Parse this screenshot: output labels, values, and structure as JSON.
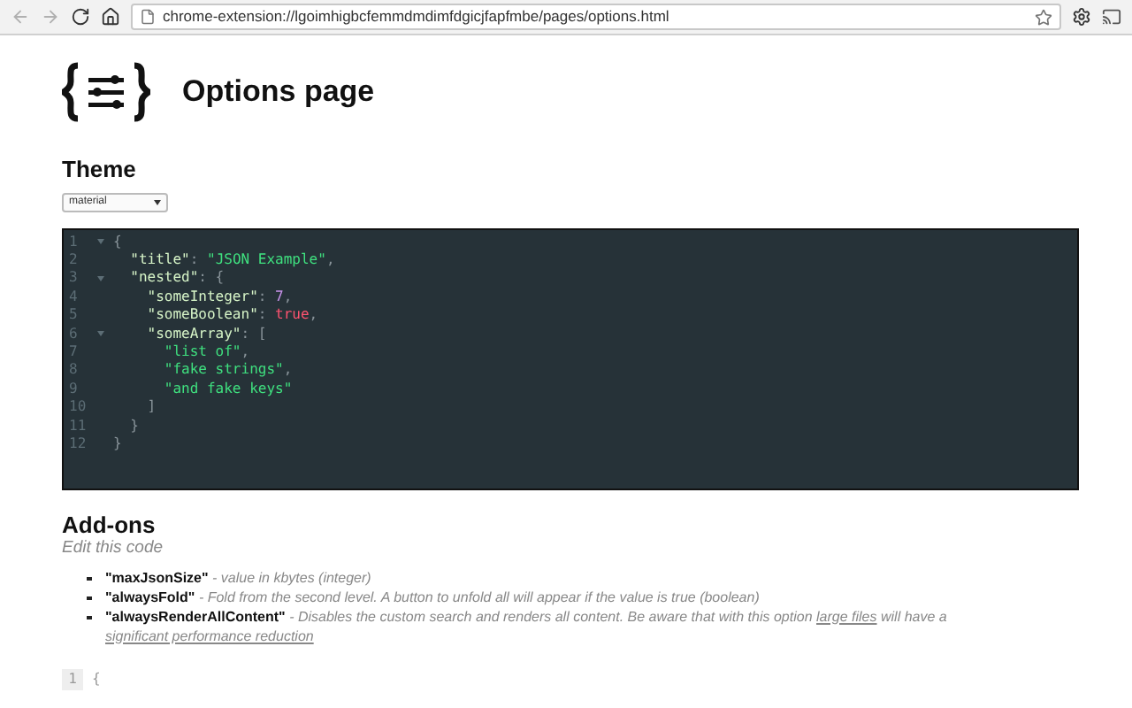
{
  "browser": {
    "url": "chrome-extension://lgoimhigbcfemmdmdimfdgicjfapfmbe/pages/options.html"
  },
  "page": {
    "title": "Options page"
  },
  "theme": {
    "heading": "Theme",
    "select_value": "material"
  },
  "editor": {
    "lines": [
      {
        "number": "1",
        "foldable": true,
        "tokens": [
          {
            "kind": "punct",
            "text": "{"
          }
        ]
      },
      {
        "number": "2",
        "foldable": false,
        "tokens": [
          {
            "kind": "key",
            "text": "  \"title\""
          },
          {
            "kind": "punct",
            "text": ": "
          },
          {
            "kind": "string",
            "text": "\"JSON Example\""
          },
          {
            "kind": "punct",
            "text": ","
          }
        ]
      },
      {
        "number": "3",
        "foldable": true,
        "tokens": [
          {
            "kind": "key",
            "text": "  \"nested\""
          },
          {
            "kind": "punct",
            "text": ": {"
          }
        ]
      },
      {
        "number": "4",
        "foldable": false,
        "tokens": [
          {
            "kind": "key",
            "text": "    \"someInteger\""
          },
          {
            "kind": "punct",
            "text": ": "
          },
          {
            "kind": "number",
            "text": "7"
          },
          {
            "kind": "punct",
            "text": ","
          }
        ]
      },
      {
        "number": "5",
        "foldable": false,
        "tokens": [
          {
            "kind": "key",
            "text": "    \"someBoolean\""
          },
          {
            "kind": "punct",
            "text": ": "
          },
          {
            "kind": "bool",
            "text": "true"
          },
          {
            "kind": "punct",
            "text": ","
          }
        ]
      },
      {
        "number": "6",
        "foldable": true,
        "tokens": [
          {
            "kind": "key",
            "text": "    \"someArray\""
          },
          {
            "kind": "punct",
            "text": ": ["
          }
        ]
      },
      {
        "number": "7",
        "foldable": false,
        "tokens": [
          {
            "kind": "string",
            "text": "      \"list of\""
          },
          {
            "kind": "punct",
            "text": ","
          }
        ]
      },
      {
        "number": "8",
        "foldable": false,
        "tokens": [
          {
            "kind": "string",
            "text": "      \"fake strings\""
          },
          {
            "kind": "punct",
            "text": ","
          }
        ]
      },
      {
        "number": "9",
        "foldable": false,
        "tokens": [
          {
            "kind": "string",
            "text": "      \"and fake keys\""
          }
        ]
      },
      {
        "number": "10",
        "foldable": false,
        "tokens": [
          {
            "kind": "punct",
            "text": "    ]"
          }
        ]
      },
      {
        "number": "11",
        "foldable": false,
        "tokens": [
          {
            "kind": "punct",
            "text": "  }"
          }
        ]
      },
      {
        "number": "12",
        "foldable": false,
        "tokens": [
          {
            "kind": "punct",
            "text": "}"
          }
        ]
      }
    ]
  },
  "addons": {
    "heading": "Add-ons",
    "subtitle": "Edit this code",
    "items": [
      {
        "key": "\"maxJsonSize\"",
        "description": [
          {
            "text": "- value in kbytes (integer)",
            "link": false
          }
        ]
      },
      {
        "key": "\"alwaysFold\"",
        "description": [
          {
            "text": "- Fold from the second level. A button to unfold all will appear if the value is true (boolean)",
            "link": false
          }
        ]
      },
      {
        "key": "\"alwaysRenderAllContent\"",
        "description": [
          {
            "text": "- Disables the custom search and renders all content. Be aware that with this option",
            "link": false
          },
          {
            "text": "large files",
            "link": true
          },
          {
            "text": "will have a",
            "link": false
          },
          {
            "text": "significant performance reduction",
            "link": true
          }
        ]
      }
    ],
    "editor": {
      "lines": [
        {
          "number": "1",
          "text": "{"
        }
      ]
    }
  }
}
